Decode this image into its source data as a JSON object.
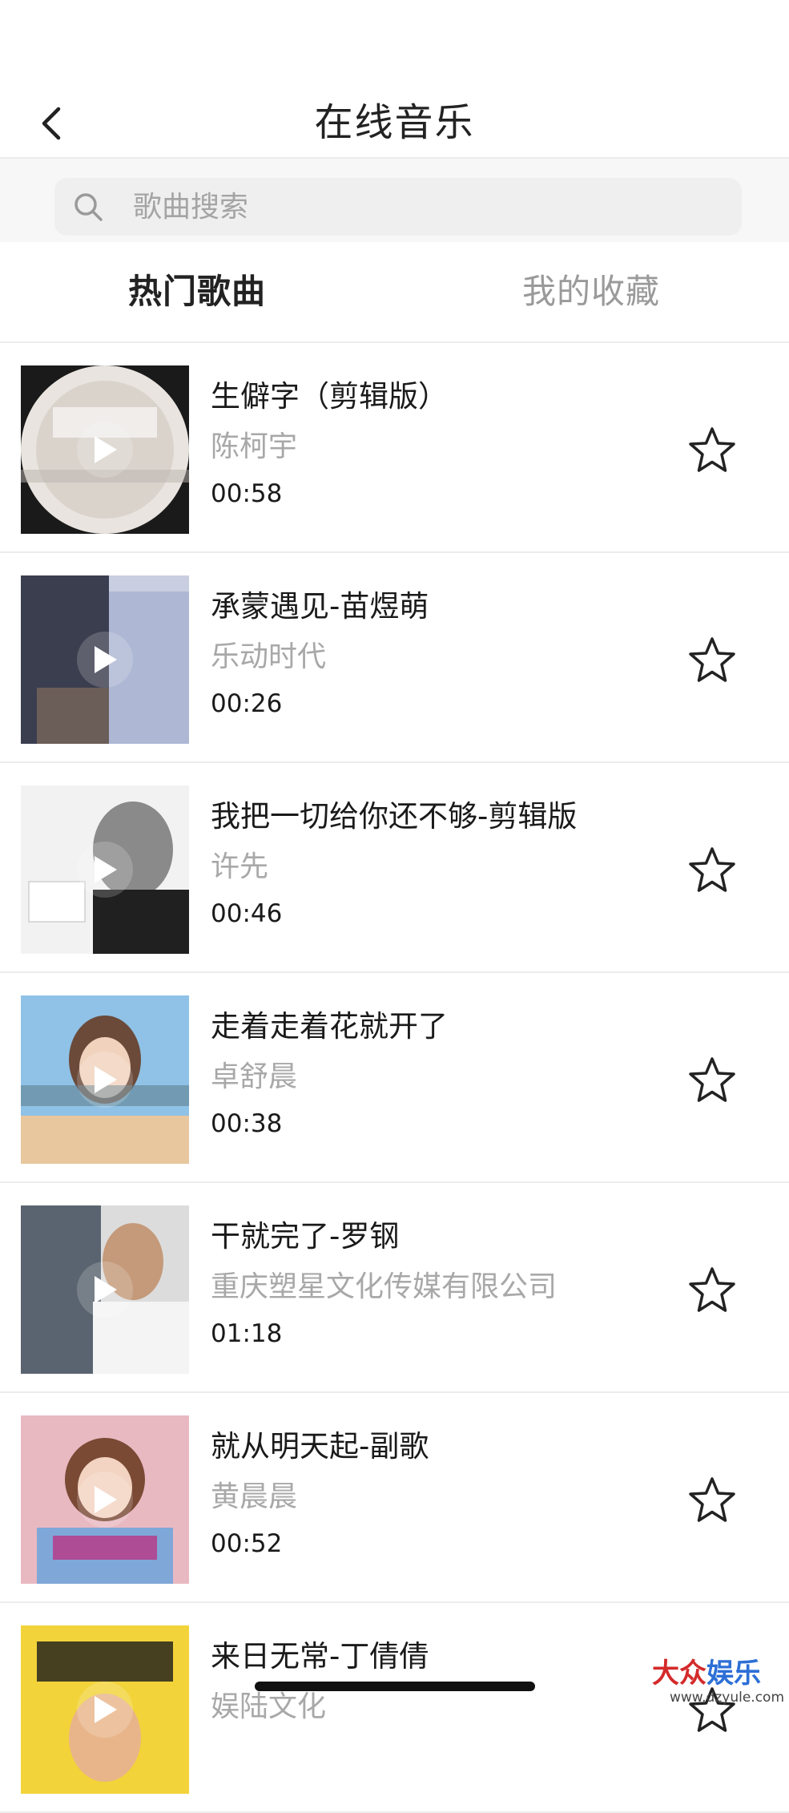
{
  "header": {
    "title": "在线音乐"
  },
  "search": {
    "placeholder": "歌曲搜索"
  },
  "tabs": [
    {
      "label": "热门歌曲",
      "active": true
    },
    {
      "label": "我的收藏",
      "active": false
    }
  ],
  "songs": [
    {
      "title": "生僻字（剪辑版）",
      "artist": "陈柯宇",
      "duration": "00:58",
      "favorite": false
    },
    {
      "title": "承蒙遇见-苗煜萌",
      "artist": "乐动时代",
      "duration": "00:26",
      "favorite": false
    },
    {
      "title": "我把一切给你还不够-剪辑版",
      "artist": "许先",
      "duration": "00:46",
      "favorite": false
    },
    {
      "title": "走着走着花就开了",
      "artist": "卓舒晨",
      "duration": "00:38",
      "favorite": false
    },
    {
      "title": "干就完了-罗钢",
      "artist": "重庆塑星文化传媒有限公司",
      "duration": "01:18",
      "favorite": false
    },
    {
      "title": "就从明天起-副歌",
      "artist": "黄晨晨",
      "duration": "00:52",
      "favorite": false
    },
    {
      "title": "来日无常-丁倩倩",
      "artist": "娱陆文化",
      "duration": "",
      "favorite": false
    }
  ],
  "watermark": {
    "brand_a": "大众",
    "brand_b": "娱乐",
    "url": "www.dzyule.com"
  },
  "colors": {
    "text_primary": "#1a1a1a",
    "text_secondary": "#a8a8a8",
    "divider": "#ececec",
    "search_bg": "#efefef"
  }
}
